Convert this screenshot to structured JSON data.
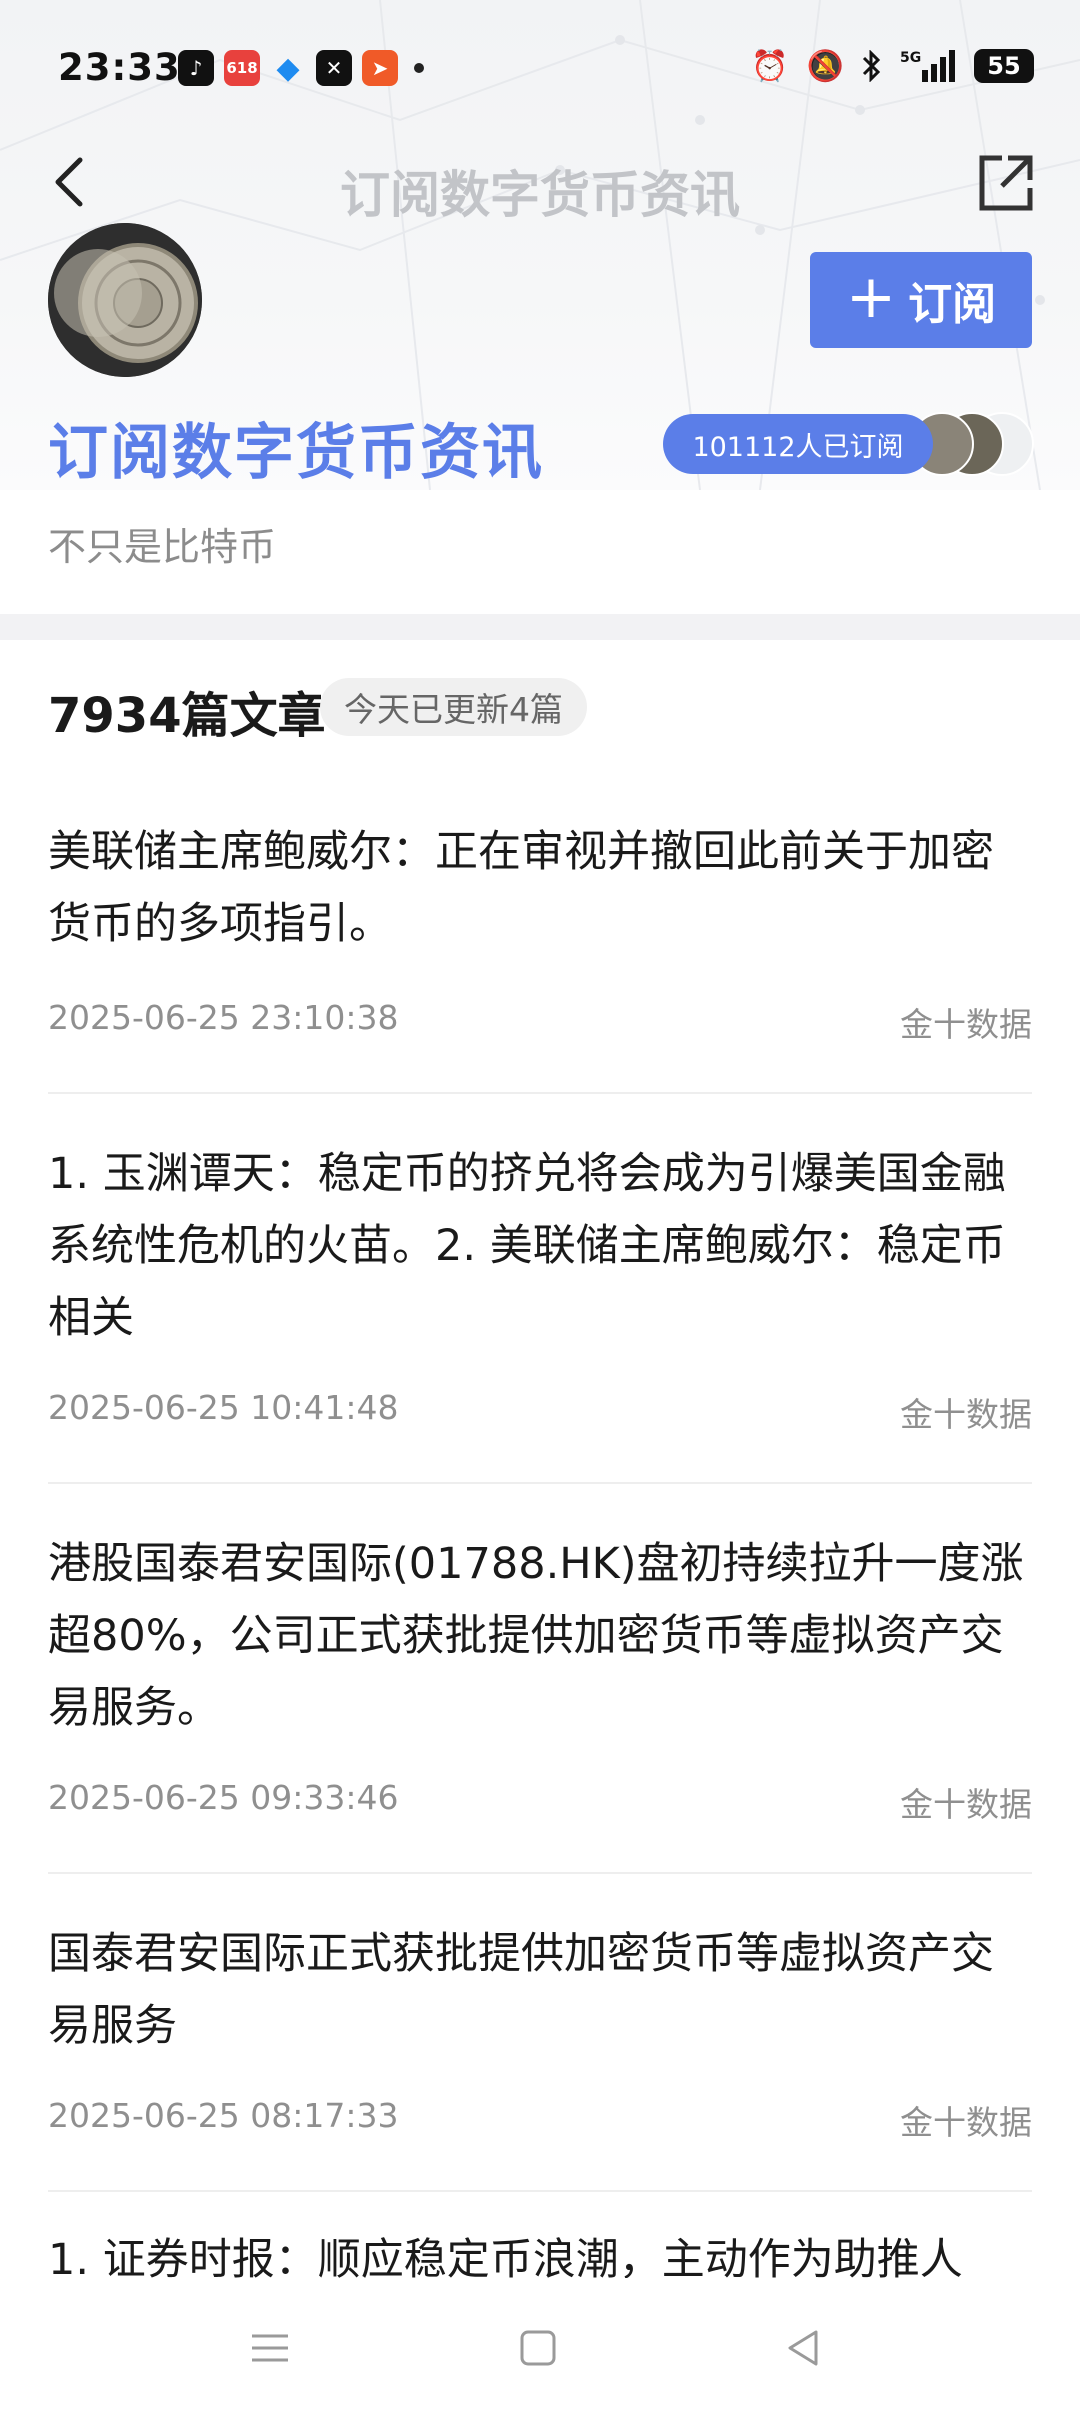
{
  "status_bar": {
    "time": "23:33",
    "network": "5G",
    "battery": "55",
    "app_icons": [
      "tiktok-icon",
      "618-promo-icon",
      "bird-app-icon",
      "capcut-icon",
      "orange-app-icon"
    ],
    "sys_icons": [
      "alarm-icon",
      "mute-icon",
      "bluetooth-icon",
      "signal-icon"
    ]
  },
  "nav": {
    "title": "订阅数字货币资讯"
  },
  "profile": {
    "name": "订阅数字货币资讯",
    "subscribe_label": "订阅",
    "subscriber_count": "101112人已订阅",
    "description": "不只是比特币"
  },
  "list_header": {
    "article_count": "7934篇文章",
    "today_update": "今天已更新4篇"
  },
  "articles": [
    {
      "title": "美联储主席鲍威尔：正在审视并撤回此前关于加密货币的多项指引。",
      "time": "2025-06-25 23:10:38",
      "source": "金十数据"
    },
    {
      "title": "1. 玉渊谭天：稳定币的挤兑将会成为引爆美国金融系统性危机的火苗。2. 美联储主席鲍威尔：稳定币相关",
      "time": "2025-06-25 10:41:48",
      "source": "金十数据"
    },
    {
      "title": "港股国泰君安国际(01788.HK)盘初持续拉升一度涨超80%，公司正式获批提供加密货币等虚拟资产交易服务。",
      "time": "2025-06-25 09:33:46",
      "source": "金十数据"
    },
    {
      "title": "国泰君安国际正式获批提供加密货币等虚拟资产交易服务",
      "time": "2025-06-25 08:17:33",
      "source": "金十数据"
    },
    {
      "title": "1. 证券时报：顺应稳定币浪潮，主动作为助推人"
    }
  ],
  "colors": {
    "accent": "#5b7ee8",
    "muted_title": "#c2c4c8",
    "meta_text": "#8f8f8f"
  }
}
